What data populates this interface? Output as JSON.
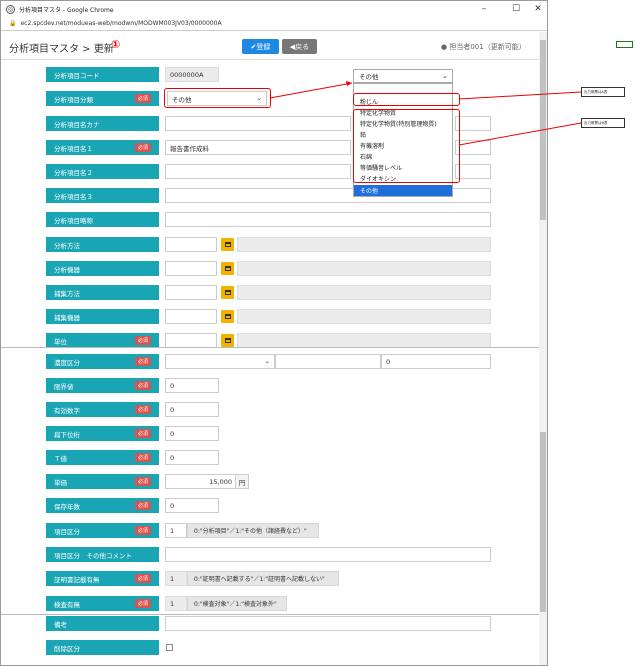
{
  "browser": {
    "window_title": "分析項目マスタ - Google Chrome",
    "url": "ec2.spcdev.net/modueas-web/modwm/MODWM003JV03/0000000A"
  },
  "header": {
    "title": "分析項目マスタ > 更新",
    "step_marker": "①",
    "register_label": "✔登録",
    "back_label": "◀戻る",
    "user": "担当者001（更新可能）"
  },
  "required_badge": "必須",
  "fields": {
    "code": {
      "label": "分析項目コード",
      "value": "0000000A"
    },
    "category": {
      "label": "分析項目分類",
      "value": "その他"
    },
    "name_kana": {
      "label": "分析項目名カナ",
      "value": ""
    },
    "name1": {
      "label": "分析項目名１",
      "value": "報告書作成料"
    },
    "name2": {
      "label": "分析項目名２",
      "value": ""
    },
    "name3": {
      "label": "分析項目名３",
      "value": ""
    },
    "abbrev": {
      "label": "分析項目略称",
      "value": ""
    },
    "method": {
      "label": "分析方法"
    },
    "equipment": {
      "label": "分析機器"
    },
    "collect_method": {
      "label": "捕集方法"
    },
    "collect_equipment": {
      "label": "捕集機器"
    },
    "unit": {
      "label": "単位"
    },
    "concentration": {
      "label": "濃度区分",
      "value2": "0"
    },
    "limit": {
      "label": "限界値",
      "value": "0"
    },
    "sig_digits": {
      "label": "有効数字",
      "value": "0"
    },
    "decimal_places": {
      "label": "扁下位桁",
      "value": "0"
    },
    "t_value": {
      "label": "Ｔ値",
      "value": "0"
    },
    "price": {
      "label": "単価",
      "value": "15,000",
      "unit": "円"
    },
    "retention": {
      "label": "保存年数",
      "value": "0"
    },
    "item_kind": {
      "label": "項目区分",
      "value": "1",
      "hint": "0:\"分析項目\"／1:\"その他（諸経費など）\""
    },
    "item_kind_comment": {
      "label": "項目区分　その他コメント"
    },
    "certificate": {
      "label": "証明書記載有無",
      "value": "1",
      "hint": "0:\"証明書へ記載する\"／1:\"証明書へ記載しない\""
    },
    "inspection": {
      "label": "検査有無",
      "value": "1",
      "hint": "0:\"検査対象\"／1:\"検査対象外\""
    },
    "remarks": {
      "label": "備考"
    },
    "deleted": {
      "label": "削除区分"
    }
  },
  "dropdown": {
    "selected": "その他",
    "options": [
      "粉じん",
      "特定化学物質",
      "特定化学物質(特別管理物質)",
      "鉛",
      "有機溶剤",
      "石綿",
      "等価騒音レベル",
      "ダイオキシン",
      "その他"
    ]
  },
  "notes": {
    "note1": "出力帳票はA表",
    "note2": "出力帳票はB表"
  }
}
